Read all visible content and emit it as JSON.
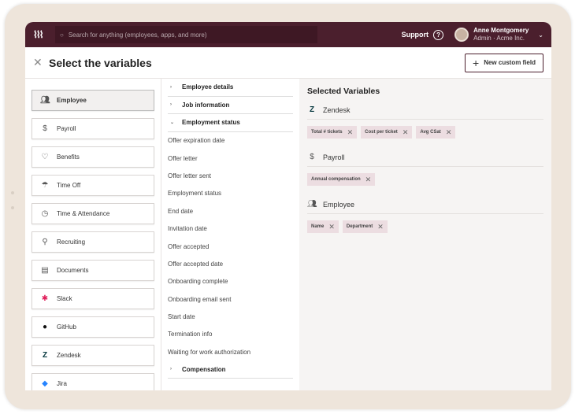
{
  "topbar": {
    "search_placeholder": "Search for anything (employees, apps, and more)",
    "support": "Support",
    "user_name": "Anne Montgomery",
    "user_role": "Admin · Acme Inc."
  },
  "header": {
    "title": "Select the variables",
    "new_field": "New custom field"
  },
  "categories": [
    "Employee",
    "Payroll",
    "Benefits",
    "Time Off",
    "Time & Attendance",
    "Recruiting",
    "Documents",
    "Slack",
    "GitHub",
    "Zendesk",
    "Jira"
  ],
  "sections": {
    "employee_details": "Employee details",
    "job_information": "Job information",
    "employment_status": "Employment status",
    "compensation": "Compensation"
  },
  "fields": [
    "Offer expiration date",
    "Offer letter",
    "Offer letter sent",
    "Employment status",
    "End date",
    "Invitation date",
    "Offer accepted",
    "Offer accepted date",
    "Onboarding complete",
    "Onboarding email sent",
    "Start date",
    "Termination info",
    "Waiting for work authorization"
  ],
  "selected": {
    "title": "Selected Variables",
    "groups": [
      {
        "name": "Zendesk",
        "chips": [
          "Total # tickets",
          "Cost per ticket",
          "Avg CSat"
        ]
      },
      {
        "name": "Payroll",
        "chips": [
          "Annual compensation"
        ]
      },
      {
        "name": "Employee",
        "chips": [
          "Name",
          "Department"
        ]
      }
    ]
  },
  "colors": {
    "brand": "#4b1f2d",
    "chip": "#ecdde1"
  }
}
